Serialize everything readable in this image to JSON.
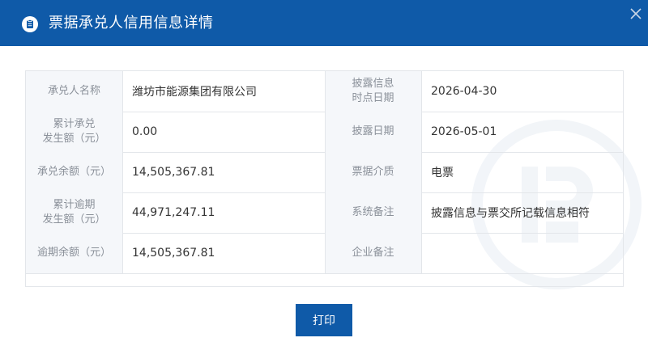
{
  "dialog": {
    "title": "票据承兑人信用信息详情",
    "print_label": "打印"
  },
  "rows": [
    {
      "label_left": "承兑人名称",
      "value_left": "潍坊市能源集团有限公司",
      "label_right": "披露信息\n时点日期",
      "value_right": "2026-04-30"
    },
    {
      "label_left": "累计承兑\n发生额（元）",
      "value_left": "0.00",
      "label_right": "披露日期",
      "value_right": "2026-05-01"
    },
    {
      "label_left": "承兑余额（元）",
      "value_left": "14,505,367.81",
      "label_right": "票据介质",
      "value_right": "电票"
    },
    {
      "label_left": "累计逾期\n发生额（元）",
      "value_left": "44,971,247.11",
      "label_right": "系统备注",
      "value_right": "披露信息与票交所记载信息相符"
    },
    {
      "label_left": "逾期余额（元）",
      "value_left": "14,505,367.81",
      "label_right": "企业备注",
      "value_right": ""
    }
  ],
  "colors": {
    "header": "#0f5aa8",
    "label_bg": "#f5f7fa",
    "border": "#e3e6ea"
  }
}
